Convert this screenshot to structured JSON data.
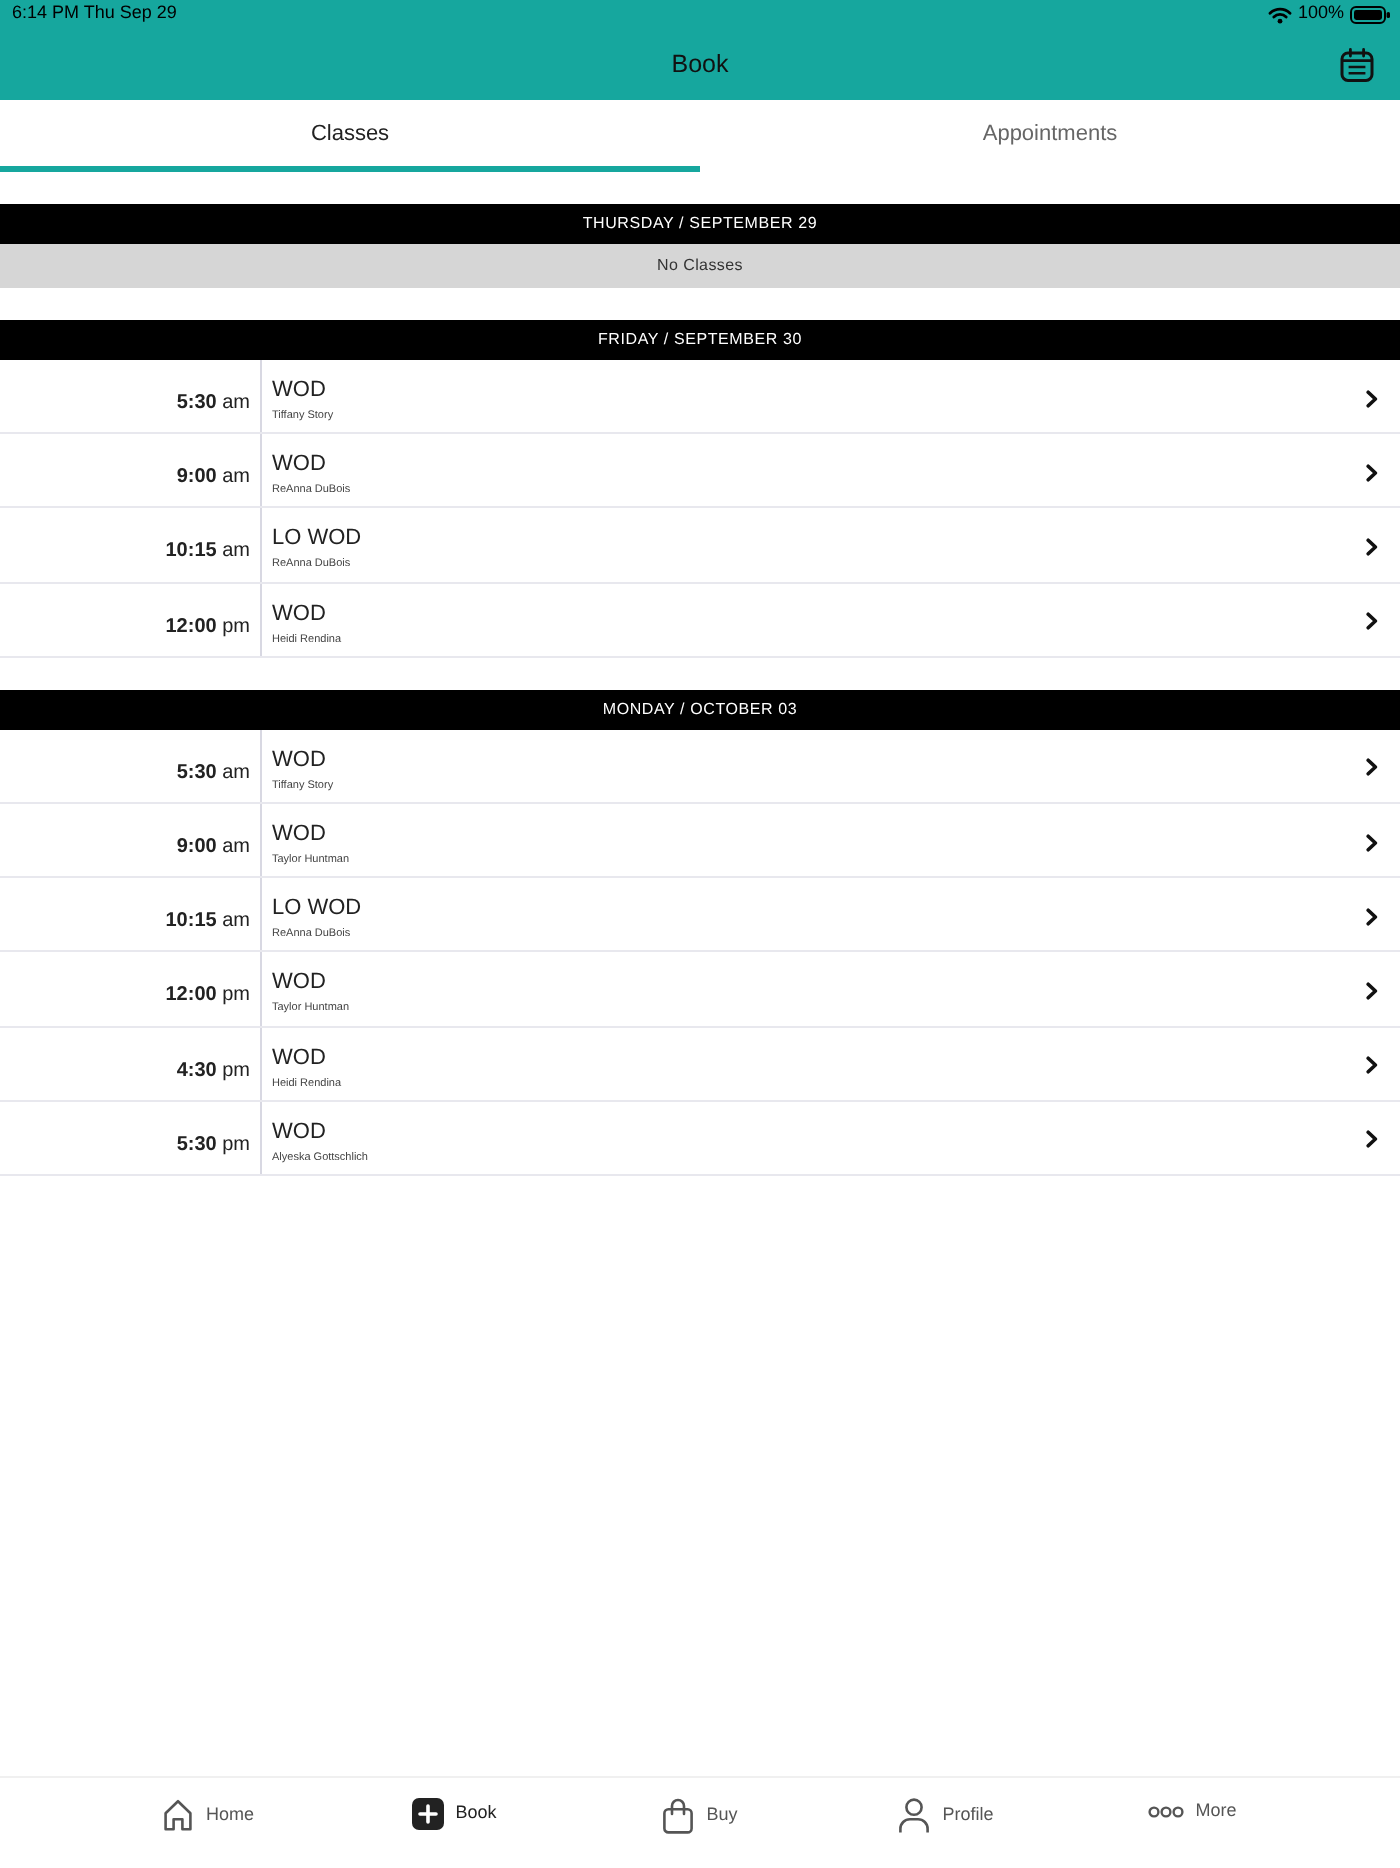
{
  "status_bar": {
    "time": "6:14 PM Thu Sep 29",
    "battery": "100%"
  },
  "header": {
    "title": "Book"
  },
  "tabs": [
    {
      "label": "Classes",
      "selected": true
    },
    {
      "label": "Appointments",
      "selected": false
    }
  ],
  "days": [
    {
      "heading": "THURSDAY / SEPTEMBER 29",
      "empty_message": "No Classes"
    },
    {
      "heading": "FRIDAY / SEPTEMBER 30",
      "classes": [
        {
          "time": "**5:30** am",
          "name": "WOD",
          "instructor": "Tiffany Story"
        },
        {
          "time": "**9:00** am",
          "name": "WOD",
          "instructor": "ReAnna DuBois"
        },
        {
          "time": "**10:15** am",
          "name": "LO WOD",
          "instructor": "ReAnna DuBois"
        },
        {
          "time": "**12:00** pm",
          "name": "WOD",
          "instructor": "Heidi Rendina"
        }
      ]
    },
    {
      "heading": "MONDAY / OCTOBER 03",
      "classes": [
        {
          "time": "**5:30** am",
          "name": "WOD",
          "instructor": "Tiffany Story"
        },
        {
          "time": "**9:00** am",
          "name": "WOD",
          "instructor": "Taylor Huntman"
        },
        {
          "time": "**10:15** am",
          "name": "LO WOD",
          "instructor": "ReAnna DuBois"
        },
        {
          "time": "**12:00** pm",
          "name": "WOD",
          "instructor": "Taylor Huntman"
        },
        {
          "time": "**4:30** pm",
          "name": "WOD",
          "instructor": "Heidi Rendina"
        },
        {
          "time": "**5:30** pm",
          "name": "WOD",
          "instructor": "Alyeska Gottschlich"
        }
      ]
    }
  ],
  "bottom_nav": [
    {
      "kind": "home",
      "label": "Home",
      "selected": false
    },
    {
      "kind": "book",
      "label": "Book",
      "selected": true
    },
    {
      "kind": "buy",
      "label": "Buy",
      "selected": false
    },
    {
      "kind": "profile",
      "label": "Profile",
      "selected": false
    },
    {
      "kind": "more",
      "label": "More",
      "selected": false
    }
  ]
}
